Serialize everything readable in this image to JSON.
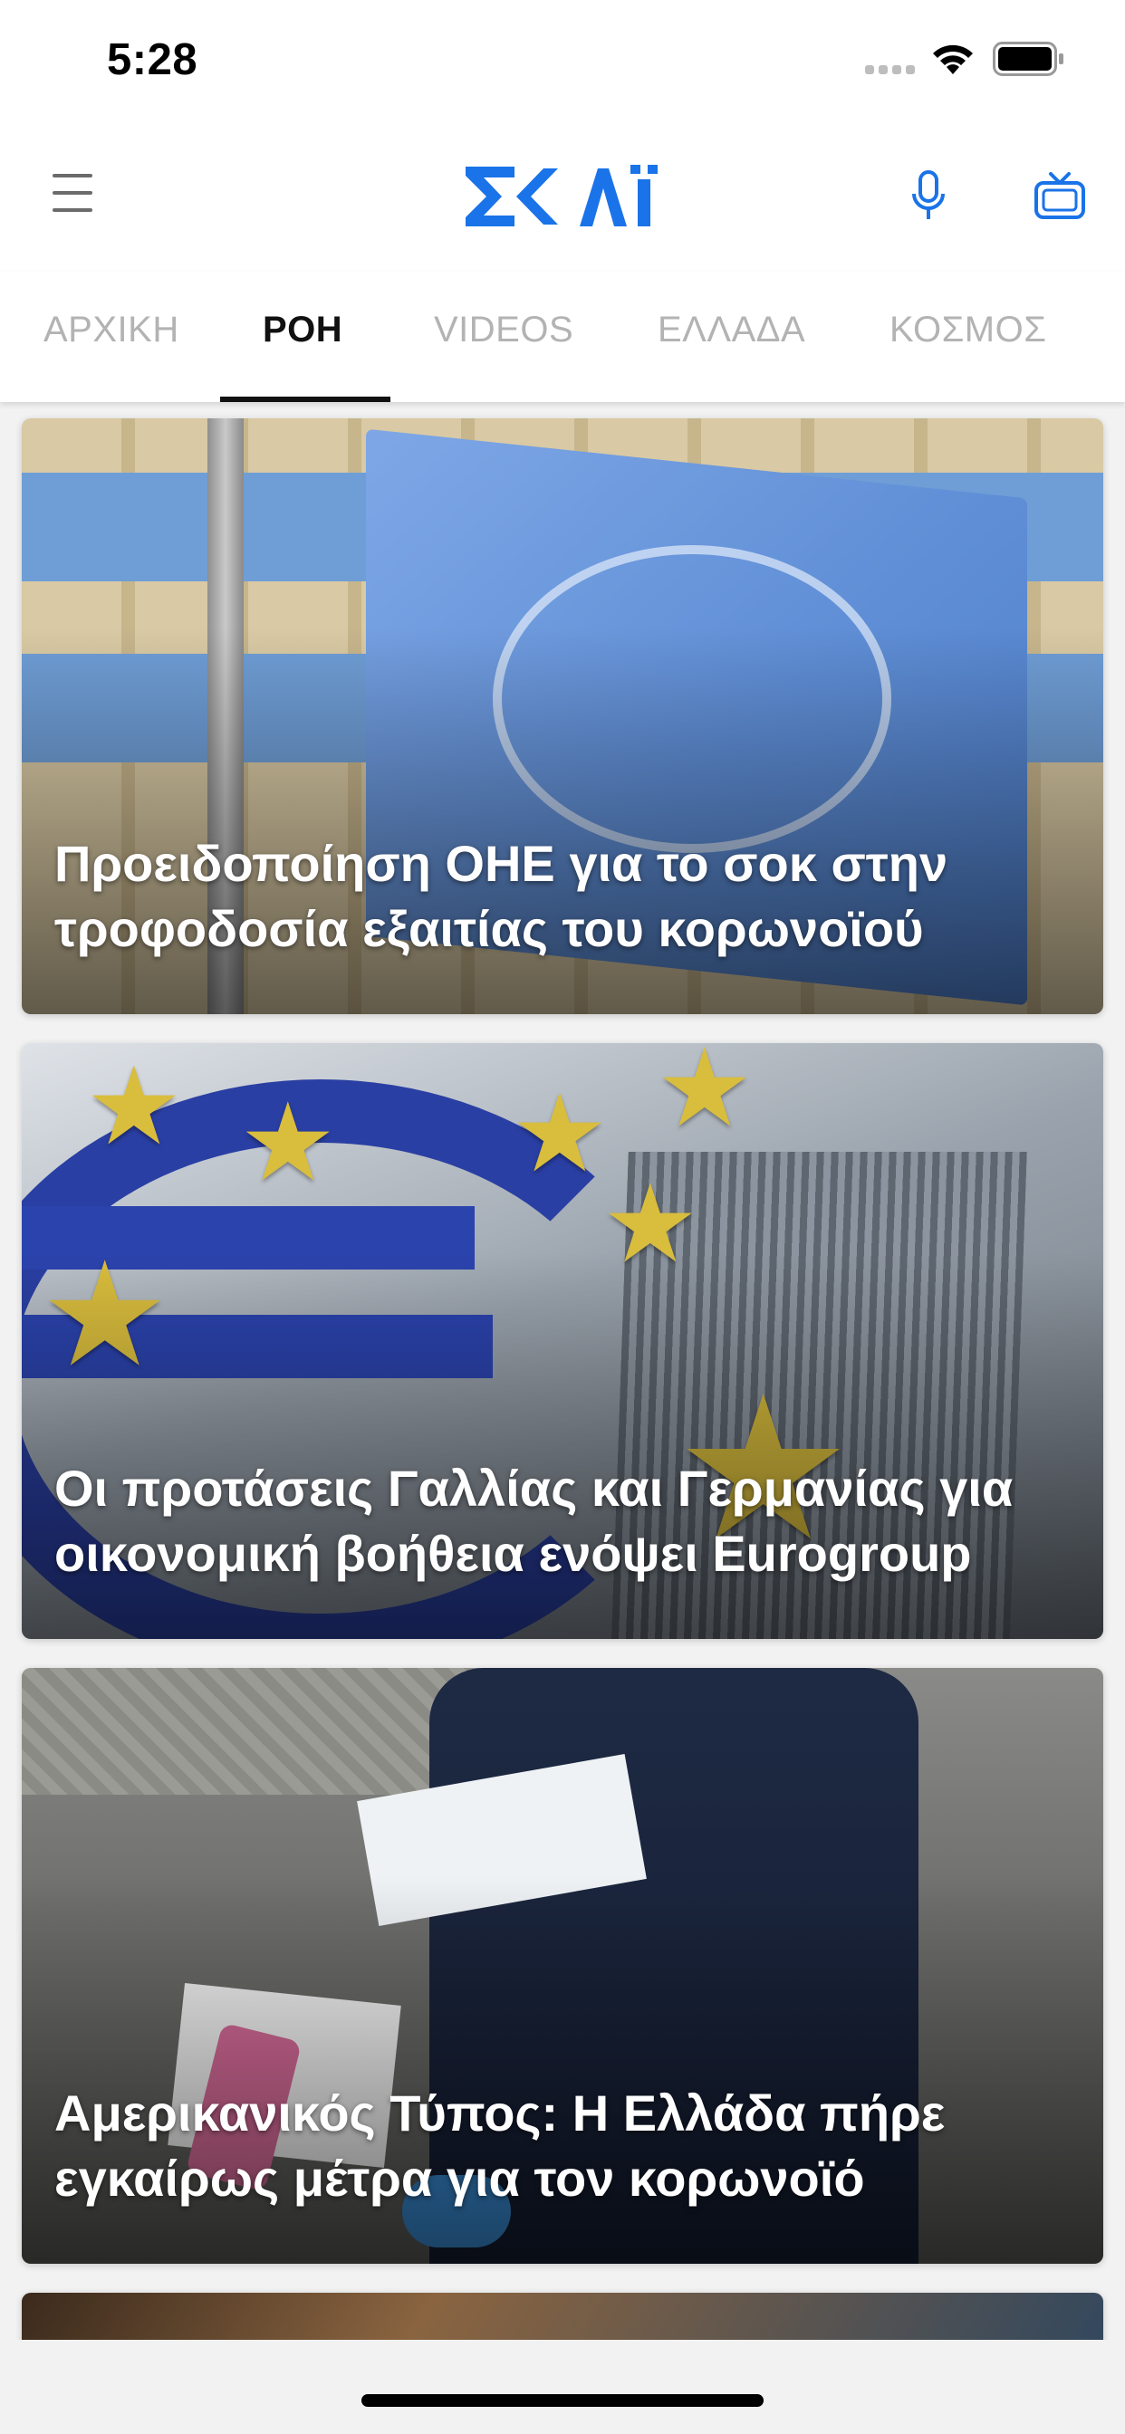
{
  "status_bar": {
    "time": "5:28"
  },
  "header": {
    "logo_text": "ΣΚΑΪ",
    "brand_color": "#1a73e8",
    "menu_icon": "hamburger-icon",
    "mic_icon": "microphone-icon",
    "tv_icon": "tv-icon"
  },
  "tabs": [
    {
      "label": "ΑΡΧΙΚΗ",
      "active": false
    },
    {
      "label": "ΡΟΗ",
      "active": true
    },
    {
      "label": "VIDEOS",
      "active": false
    },
    {
      "label": "ΕΛΛΑΔΑ",
      "active": false
    },
    {
      "label": "ΚΟΣΜΟΣ",
      "active": false
    }
  ],
  "articles": [
    {
      "headline": "Προειδοποίηση ΟΗΕ για το σοκ στην τροφοδοσία εξαιτίας του κορωνοϊού"
    },
    {
      "headline": "Οι προτάσεις Γαλλίας και Γερμανίας για οικονομική βοήθεια ενόψει Eurogroup"
    },
    {
      "headline": "Αμερικανικός Τύπος: Η Ελλάδα πήρε εγκαίρως μέτρα για τον κορωνοϊό"
    }
  ]
}
